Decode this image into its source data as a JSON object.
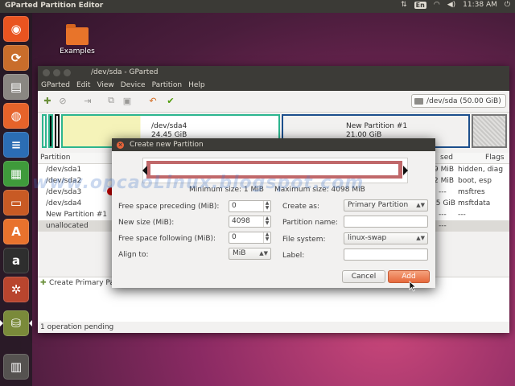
{
  "top_panel": {
    "title": "GParted Partition Editor",
    "keyboard": "En",
    "time": "11:38 AM",
    "icons": [
      "sort-icon",
      "keyboard-icon",
      "wifi-icon",
      "volume-icon",
      "power-icon"
    ]
  },
  "launcher": {
    "items": [
      {
        "name": "ubuntu-dash-icon",
        "glyph": "◉",
        "color": "#e95420"
      },
      {
        "name": "software-updater-icon",
        "glyph": "⟳",
        "color": "#c96d2b"
      },
      {
        "name": "files-icon",
        "glyph": "▤",
        "color": "#8a8782"
      },
      {
        "name": "firefox-icon",
        "glyph": "◍",
        "color": "#e6632a"
      },
      {
        "name": "writer-icon",
        "glyph": "≡",
        "color": "#2b6db4"
      },
      {
        "name": "calc-icon",
        "glyph": "▦",
        "color": "#3f9a3b"
      },
      {
        "name": "impress-icon",
        "glyph": "▭",
        "color": "#c85a24"
      },
      {
        "name": "software-center-icon",
        "glyph": "A",
        "color": "#e8722d"
      },
      {
        "name": "amazon-icon",
        "glyph": "a",
        "color": "#2e2e2e"
      },
      {
        "name": "system-settings-icon",
        "glyph": "✲",
        "color": "#b8452e"
      },
      {
        "name": "gparted-icon",
        "glyph": "⛁",
        "color": "#7a8a3a"
      },
      {
        "name": "trash-icon",
        "glyph": "🗑",
        "color": "#555250"
      }
    ]
  },
  "desktop": {
    "examples_label": "Examples"
  },
  "window": {
    "title": "/dev/sda - GParted",
    "menu": [
      "GParted",
      "Edit",
      "View",
      "Device",
      "Partition",
      "Help"
    ],
    "device": "/dev/sda   (50.00 GiB)",
    "map": {
      "sda4_name": "/dev/sda4",
      "sda4_size": "24.45 GiB",
      "newpart_name": "New Partition #1",
      "newpart_size": "21.00 GiB"
    },
    "columns": {
      "partition": "Partition",
      "used": "sed",
      "flags": "Flags"
    },
    "rows": [
      {
        "partition": "/dev/sda1",
        "used": "9 MiB",
        "flags": "hidden, diag"
      },
      {
        "partition": "/dev/sda2",
        "used": "2 MiB",
        "flags": "boot, esp"
      },
      {
        "partition": "/dev/sda3",
        "used": "---",
        "flags": "msftres"
      },
      {
        "partition": "/dev/sda4",
        "used": "35 GiB",
        "flags": "msftdata"
      },
      {
        "partition": "New Partition #1",
        "used": "---",
        "flags": "---"
      },
      {
        "partition": "unallocated",
        "used": "---",
        "flags": ""
      }
    ],
    "pending_item": "Create Primary Par",
    "status": "1 operation pending"
  },
  "dialog": {
    "title": "Create new Partition",
    "min_size": "Minimum size: 1 MiB",
    "max_size": "Maximum size: 4098 MiB",
    "free_preceding_label": "Free space preceding (MiB):",
    "free_preceding_value": "0",
    "new_size_label": "New size (MiB):",
    "new_size_value": "4098",
    "free_following_label": "Free space following (MiB):",
    "free_following_value": "0",
    "align_label": "Align to:",
    "align_value": "MiB",
    "create_as_label": "Create as:",
    "create_as_value": "Primary Partition",
    "partition_name_label": "Partition name:",
    "file_system_label": "File system:",
    "file_system_value": "linux-swap",
    "label_label": "Label:",
    "cancel": "Cancel",
    "add": "Add"
  },
  "watermark": "www.opcaoLinux.blogspot.com",
  "colors": {
    "accent": "#e95420",
    "add_button": "#e6693c",
    "resizer": "#c0686a",
    "ntfs_green": "#2cb58e",
    "extended_blue": "#1c4f8c"
  }
}
